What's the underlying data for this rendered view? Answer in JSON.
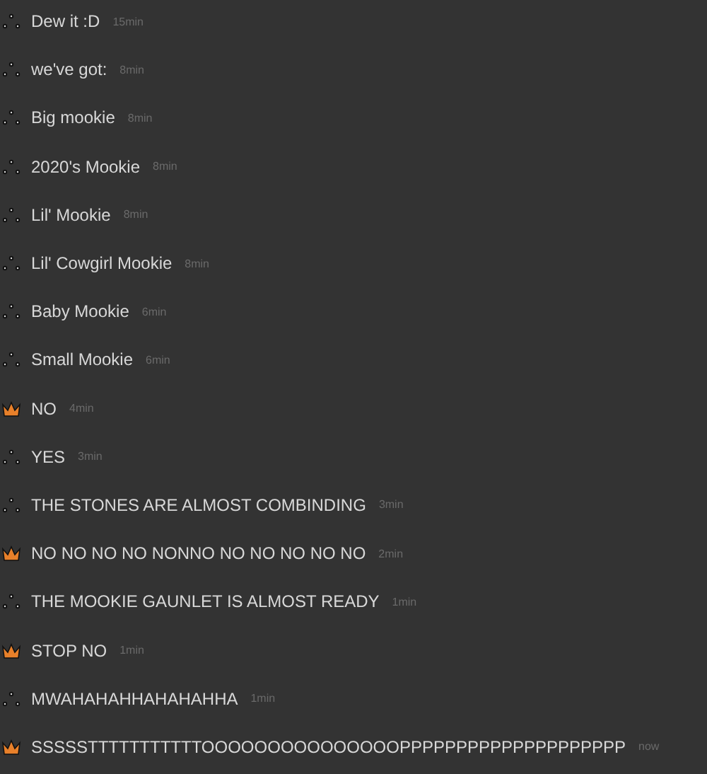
{
  "messages": [
    {
      "kind": "member",
      "text": "Dew it :D",
      "time": "15min"
    },
    {
      "kind": "member",
      "text": "we've got:",
      "time": "8min"
    },
    {
      "kind": "member",
      "text": "Big mookie",
      "time": "8min"
    },
    {
      "kind": "member",
      "text": "2020's Mookie",
      "time": "8min"
    },
    {
      "kind": "member",
      "text": "Lil' Mookie",
      "time": "8min"
    },
    {
      "kind": "member",
      "text": "Lil' Cowgirl Mookie",
      "time": "8min"
    },
    {
      "kind": "member",
      "text": "Baby Mookie",
      "time": "6min"
    },
    {
      "kind": "member",
      "text": "Small Mookie",
      "time": "6min"
    },
    {
      "kind": "owner",
      "text": "NO",
      "time": "4min"
    },
    {
      "kind": "member",
      "text": "YES",
      "time": "3min"
    },
    {
      "kind": "member",
      "text": "THE STONES ARE ALMOST COMBINDING",
      "time": "3min"
    },
    {
      "kind": "owner",
      "text": "NO NO NO NO NONNO NO NO NO NO NO",
      "time": "2min"
    },
    {
      "kind": "member",
      "text": "THE MOOKIE GAUNLET IS ALMOST READY",
      "time": "1min"
    },
    {
      "kind": "owner",
      "text": "STOP NO",
      "time": "1min"
    },
    {
      "kind": "member",
      "text": "MWAHAHAHHAHAHAHHA",
      "time": "1min"
    },
    {
      "kind": "owner",
      "text": "SSSSSTTTTTTTTTTTOOOOOOOOOOOOOOOPPPPPPPPPPPPPPPPPPPP",
      "time": "now"
    }
  ]
}
